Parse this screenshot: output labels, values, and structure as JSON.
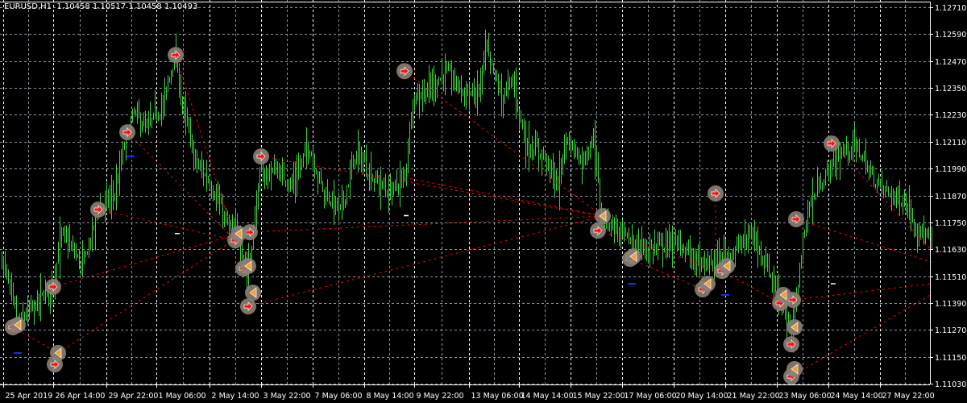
{
  "header": {
    "title": "EURUSD,H1  1.10458 1.10517 1.10458 1.10493"
  },
  "colors": {
    "background": "#000000",
    "bars": "#3fd13f",
    "grid": "#8a96a3",
    "major_grid": "#ffffff",
    "trade_line": "#ff0000",
    "marker_bg": "#8c7f73",
    "buy_arrow": "#ff1010",
    "close_arrow": "#f0a030",
    "level_blue": "#1030ff",
    "level_white": "#ffffff"
  },
  "chart_data": {
    "type": "bar",
    "title": "EURUSD,H1",
    "symbol": "EURUSD",
    "timeframe": "H1",
    "last_ohlc": {
      "open": 1.10458,
      "high": 1.10517,
      "low": 1.10458,
      "close": 1.10493
    },
    "ylim": [
      1.1103,
      1.1271
    ],
    "xlim_bars": [
      0,
      577
    ],
    "y_ticks": [
      "1.12710",
      "1.12590",
      "1.12470",
      "1.12350",
      "1.12230",
      "1.12110",
      "1.11990",
      "1.11870",
      "1.11750",
      "1.11630",
      "1.11510",
      "1.11390",
      "1.11270",
      "1.11150",
      "1.11030"
    ],
    "x_ticks": [
      {
        "bar": 1,
        "label": "25 Apr 2019"
      },
      {
        "bar": 32,
        "label": "26 Apr 14:00"
      },
      {
        "bar": 65,
        "label": "29 Apr 22:00"
      },
      {
        "bar": 96,
        "label": "1 May 06:00"
      },
      {
        "bar": 129,
        "label": "2 May 14:00"
      },
      {
        "bar": 161,
        "label": "3 May 22:00"
      },
      {
        "bar": 193,
        "label": "7 May 06:00"
      },
      {
        "bar": 225,
        "label": "8 May 14:00"
      },
      {
        "bar": 256,
        "label": "9 May 22:00"
      },
      {
        "bar": 290,
        "label": "13 May 06:00"
      },
      {
        "bar": 321,
        "label": "14 May 14:00"
      },
      {
        "bar": 353,
        "label": "15 May 22:00"
      },
      {
        "bar": 385,
        "label": "17 May 06:00"
      },
      {
        "bar": 417,
        "label": "20 May 14:00"
      },
      {
        "bar": 449,
        "label": "21 May 22:00"
      },
      {
        "bar": 481,
        "label": "23 May 06:00"
      },
      {
        "bar": 513,
        "label": "24 May 14:00"
      },
      {
        "bar": 545,
        "label": "27 May 22:00"
      }
    ],
    "price_path": [
      [
        0,
        1.11591
      ],
      [
        10,
        1.11303
      ],
      [
        20,
        1.11375
      ],
      [
        32,
        1.11483
      ],
      [
        37,
        1.11699
      ],
      [
        50,
        1.11555
      ],
      [
        60,
        1.11807
      ],
      [
        70,
        1.11879
      ],
      [
        77,
        1.12131
      ],
      [
        82,
        1.12238
      ],
      [
        90,
        1.12167
      ],
      [
        100,
        1.12274
      ],
      [
        107,
        1.1249
      ],
      [
        112,
        1.12274
      ],
      [
        120,
        1.12023
      ],
      [
        130,
        1.11915
      ],
      [
        140,
        1.11735
      ],
      [
        147,
        1.11699
      ],
      [
        152,
        1.11519
      ],
      [
        155,
        1.11663
      ],
      [
        160,
        1.11951
      ],
      [
        170,
        1.11987
      ],
      [
        180,
        1.11915
      ],
      [
        190,
        1.12095
      ],
      [
        200,
        1.11879
      ],
      [
        210,
        1.11807
      ],
      [
        220,
        1.12059
      ],
      [
        230,
        1.11951
      ],
      [
        240,
        1.11879
      ],
      [
        250,
        1.11951
      ],
      [
        255,
        1.1231
      ],
      [
        265,
        1.12346
      ],
      [
        275,
        1.12418
      ],
      [
        285,
        1.12346
      ],
      [
        295,
        1.1231
      ],
      [
        300,
        1.12526
      ],
      [
        310,
        1.1231
      ],
      [
        317,
        1.12382
      ],
      [
        325,
        1.12095
      ],
      [
        335,
        1.12059
      ],
      [
        345,
        1.11915
      ],
      [
        350,
        1.12131
      ],
      [
        360,
        1.12023
      ],
      [
        367,
        1.12131
      ],
      [
        372,
        1.11771
      ],
      [
        380,
        1.11735
      ],
      [
        390,
        1.11663
      ],
      [
        400,
        1.11627
      ],
      [
        415,
        1.11663
      ],
      [
        425,
        1.11627
      ],
      [
        435,
        1.11555
      ],
      [
        445,
        1.11591
      ],
      [
        455,
        1.11627
      ],
      [
        465,
        1.11699
      ],
      [
        475,
        1.11555
      ],
      [
        485,
        1.11375
      ],
      [
        490,
        1.11231
      ],
      [
        495,
        1.11555
      ],
      [
        500,
        1.11807
      ],
      [
        510,
        1.11951
      ],
      [
        520,
        1.12059
      ],
      [
        530,
        1.12095
      ],
      [
        540,
        1.11951
      ],
      [
        550,
        1.11879
      ],
      [
        560,
        1.11843
      ],
      [
        570,
        1.11699
      ],
      [
        577,
        1.11663
      ]
    ],
    "buy_markers": [
      [
        7,
        1.11282
      ],
      [
        32,
        1.11462
      ],
      [
        33,
        1.11116
      ],
      [
        60,
        1.11807
      ],
      [
        78,
        1.12152
      ],
      [
        108,
        1.12497
      ],
      [
        145,
        1.1167
      ],
      [
        154,
        1.11706
      ],
      [
        161,
        1.12044
      ],
      [
        150,
        1.11544
      ],
      [
        153,
        1.11375
      ],
      [
        250,
        1.12425
      ],
      [
        370,
        1.11713
      ],
      [
        390,
        1.11587
      ],
      [
        435,
        1.11451
      ],
      [
        443,
        1.11879
      ],
      [
        447,
        1.11533
      ],
      [
        483,
        1.1139
      ],
      [
        490,
        1.11206
      ],
      [
        493,
        1.11764
      ],
      [
        491,
        1.11404
      ],
      [
        490,
        1.11062
      ],
      [
        515,
        1.12102
      ]
    ],
    "close_markers": [
      [
        10,
        1.11292
      ],
      [
        35,
        1.11167
      ],
      [
        147,
        1.11699
      ],
      [
        153,
        1.11555
      ],
      [
        156,
        1.11436
      ],
      [
        373,
        1.11778
      ],
      [
        392,
        1.11598
      ],
      [
        438,
        1.11476
      ],
      [
        450,
        1.11555
      ],
      [
        485,
        1.11426
      ],
      [
        492,
        1.11282
      ],
      [
        492,
        1.11095
      ]
    ],
    "trade_lines": [
      [
        [
          108,
          1.12497
        ],
        [
          145,
          1.1167
        ]
      ],
      [
        [
          78,
          1.12152
        ],
        [
          145,
          1.1167
        ]
      ],
      [
        [
          60,
          1.11807
        ],
        [
          145,
          1.1167
        ]
      ],
      [
        [
          32,
          1.11462
        ],
        [
          147,
          1.11699
        ]
      ],
      [
        [
          35,
          1.11167
        ],
        [
          150,
          1.11699
        ]
      ],
      [
        [
          7,
          1.11282
        ],
        [
          35,
          1.11167
        ]
      ],
      [
        [
          161,
          1.12044
        ],
        [
          373,
          1.11778
        ]
      ],
      [
        [
          154,
          1.11706
        ],
        [
          373,
          1.11778
        ]
      ],
      [
        [
          153,
          1.11375
        ],
        [
          373,
          1.11778
        ]
      ],
      [
        [
          250,
          1.12425
        ],
        [
          373,
          1.11778
        ]
      ],
      [
        [
          250,
          1.1195
        ],
        [
          373,
          1.11778
        ]
      ],
      [
        [
          370,
          1.11713
        ],
        [
          447,
          1.11533
        ]
      ],
      [
        [
          390,
          1.11587
        ],
        [
          435,
          1.11451
        ]
      ],
      [
        [
          443,
          1.11879
        ],
        [
          443,
          1.11555
        ]
      ],
      [
        [
          447,
          1.11533
        ],
        [
          483,
          1.1139
        ]
      ],
      [
        [
          493,
          1.11764
        ],
        [
          577,
          1.11573
        ]
      ],
      [
        [
          515,
          1.12102
        ],
        [
          577,
          1.11627
        ]
      ],
      [
        [
          491,
          1.11404
        ],
        [
          577,
          1.11476
        ]
      ],
      [
        [
          490,
          1.11062
        ],
        [
          577,
          1.11429
        ]
      ]
    ],
    "level_marks_blue": [
      [
        10,
        1.11167
      ],
      [
        80,
        1.12044
      ],
      [
        150,
        1.11555
      ],
      [
        391,
        1.11476
      ],
      [
        449,
        1.11426
      ],
      [
        492,
        1.11296
      ]
    ],
    "level_marks_white": [
      [
        109,
        1.117
      ],
      [
        251,
        1.1178
      ],
      [
        516,
        1.11476
      ]
    ]
  }
}
